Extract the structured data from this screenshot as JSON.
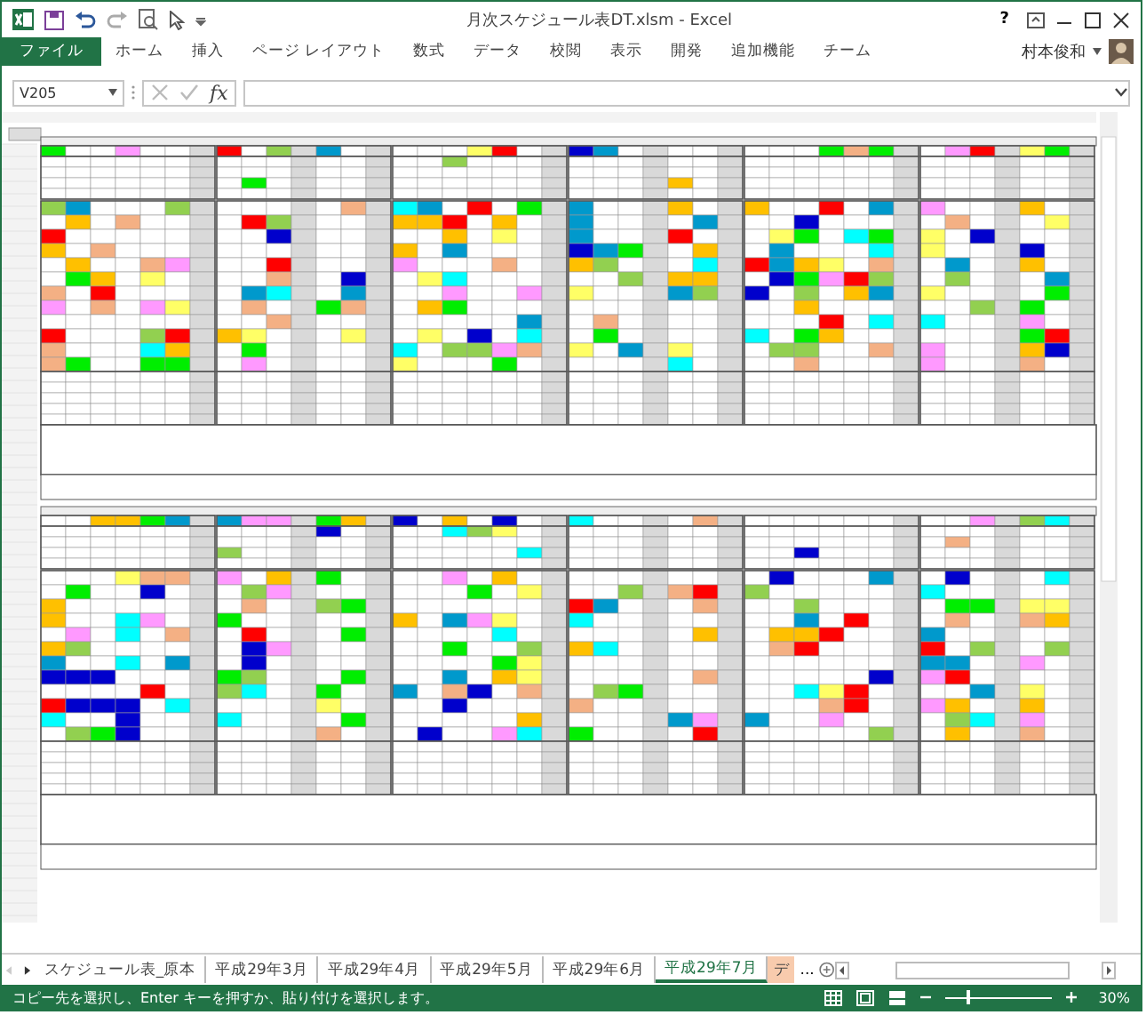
{
  "window": {
    "title": "月次スケジュール表DT.xlsm - Excel",
    "help": "?",
    "user": "村本俊和"
  },
  "ribbon_tabs": [
    {
      "label": "ファイル",
      "kind": "file",
      "selected": false
    },
    {
      "label": "ホーム",
      "kind": "tab",
      "selected": false
    },
    {
      "label": "挿入",
      "kind": "tab",
      "selected": false
    },
    {
      "label": "ページ レイアウト",
      "kind": "tab",
      "selected": false
    },
    {
      "label": "数式",
      "kind": "tab",
      "selected": false
    },
    {
      "label": "データ",
      "kind": "tab",
      "selected": false
    },
    {
      "label": "校閲",
      "kind": "tab",
      "selected": false
    },
    {
      "label": "表示",
      "kind": "tab",
      "selected": false
    },
    {
      "label": "開発",
      "kind": "tab",
      "selected": false
    },
    {
      "label": "追加機能",
      "kind": "tab",
      "selected": false
    },
    {
      "label": "チーム",
      "kind": "tab",
      "selected": false
    }
  ],
  "formula_bar": {
    "name_box": "V205",
    "fx": "fx"
  },
  "sheet_tabs": [
    {
      "label": "スケジュール表_原本",
      "selected": false
    },
    {
      "label": "平成29年3月",
      "selected": false
    },
    {
      "label": "平成29年4月",
      "selected": false
    },
    {
      "label": "平成29年5月",
      "selected": false
    },
    {
      "label": "平成29年6月",
      "selected": false
    },
    {
      "label": "平成29年7月",
      "selected": true
    },
    {
      "label": "デ",
      "selected": false
    }
  ],
  "more_tabs": "...",
  "status_bar": {
    "message": "コピー先を選択し、Enter キーを押すか、貼り付けを選択します。",
    "zoom": "30%",
    "zoom_slider": {
      "level": 0.2
    }
  }
}
